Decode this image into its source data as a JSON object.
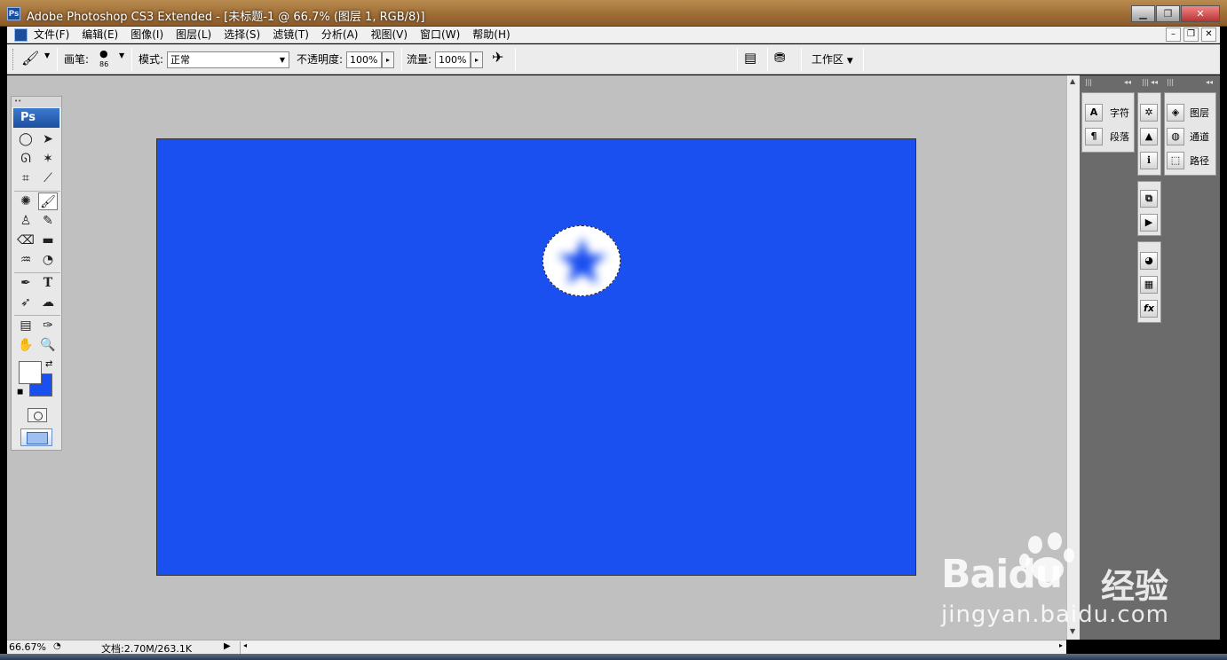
{
  "window": {
    "title": "Adobe Photoshop CS3 Extended - [未标题-1 @ 66.7% (图层 1, RGB/8)]",
    "ps_logo": "Ps",
    "controls": [
      "minimize-icon",
      "restore-icon",
      "close-icon"
    ]
  },
  "menu": {
    "items": [
      "文件(F)",
      "编辑(E)",
      "图像(I)",
      "图层(L)",
      "选择(S)",
      "滤镜(T)",
      "分析(A)",
      "视图(V)",
      "窗口(W)",
      "帮助(H)"
    ]
  },
  "options": {
    "brush_label": "画笔:",
    "brush_size": "86",
    "mode_label": "模式:",
    "mode_value": "正常",
    "opacity_label": "不透明度:",
    "opacity_value": "100%",
    "flow_label": "流量:",
    "flow_value": "100%",
    "workspace_label": "工作区"
  },
  "toolbox": {
    "logo": "Ps",
    "foreground_color": "#ffffff",
    "background_color": "#1a4ff0"
  },
  "canvas": {
    "fill_color": "#1a4ff0",
    "selection": "elliptical marquee with white feathered star"
  },
  "panels": {
    "char_group": [
      {
        "icon": "character-icon",
        "label": "字符"
      },
      {
        "icon": "paragraph-icon",
        "label": "段落"
      }
    ],
    "layers_group": [
      {
        "icon": "layers-icon",
        "label": "图层"
      },
      {
        "icon": "channels-icon",
        "label": "通道"
      },
      {
        "icon": "paths-icon",
        "label": "路径"
      }
    ],
    "icon_column": [
      "navigator-icon",
      "histogram-icon",
      "info-icon",
      "history-icon",
      "actions-icon",
      "swatches-icon",
      "styles-icon",
      "fx-icon"
    ]
  },
  "status": {
    "zoom": "66.67%",
    "doc_info": "文档:2.70M/263.1K"
  },
  "watermark": {
    "brand": "Bai",
    "brand2": "du",
    "suffix": "经验",
    "url": "jingyan.baidu.com"
  }
}
